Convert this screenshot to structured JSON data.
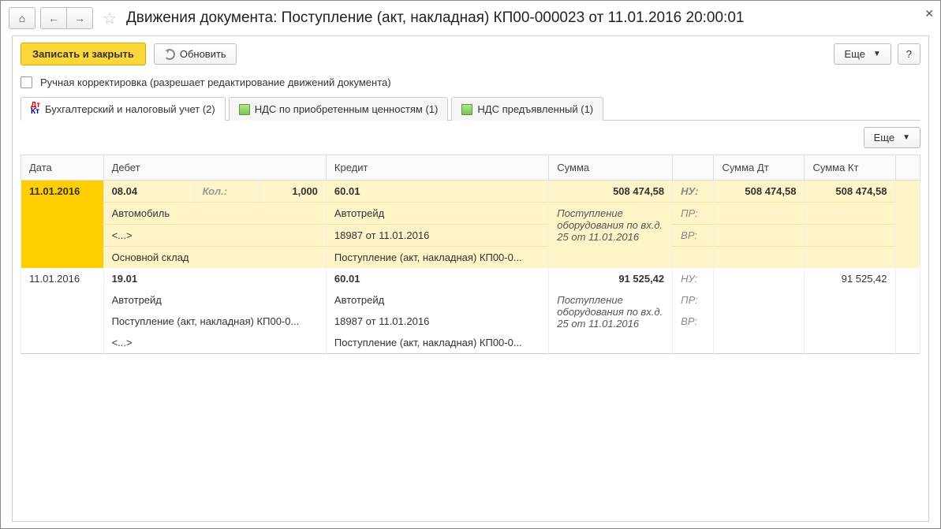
{
  "title": "Движения документа: Поступление (акт, накладная) КП00-000023 от 11.01.2016 20:00:01",
  "buttons": {
    "save_close": "Записать и закрыть",
    "refresh": "Обновить",
    "more": "Еще",
    "help": "?"
  },
  "checkbox": {
    "label": "Ручная корректировка (разрешает редактирование движений документа)"
  },
  "tabs": [
    {
      "label": "Бухгалтерский и налоговый учет (2)"
    },
    {
      "label": "НДС по приобретенным ценностям (1)"
    },
    {
      "label": "НДС предъявленный (1)"
    }
  ],
  "headers": {
    "date": "Дата",
    "debit": "Дебет",
    "credit": "Кредит",
    "sum": "Сумма",
    "sum_dt": "Сумма Дт",
    "sum_kt": "Сумма Кт"
  },
  "rows": [
    {
      "date": "11.01.2016",
      "debit_acc": "08.04",
      "kol_label": "Кол.:",
      "kol_val": "1,000",
      "credit_acc": "60.01",
      "sum": "508 474,58",
      "tag1": "НУ:",
      "sum_dt": "508 474,58",
      "sum_kt": "508 474,58",
      "d1": "Автомобиль",
      "c1": "Автотрейд",
      "note": "Поступление оборудования по вх.д. 25 от 11.01.2016",
      "tag2": "ПР:",
      "d2": "<...>",
      "c2": "18987 от 11.01.2016",
      "tag3": "ВР:",
      "d3": "Основной склад",
      "c3": "Поступление (акт, накладная) КП00-0..."
    },
    {
      "date": "11.01.2016",
      "debit_acc": "19.01",
      "credit_acc": "60.01",
      "sum": "91 525,42",
      "tag1": "НУ:",
      "sum_dt": "",
      "sum_kt": "91 525,42",
      "d1": "Автотрейд",
      "c1": "Автотрейд",
      "note": "Поступление оборудования по вх.д. 25 от 11.01.2016",
      "tag2": "ПР:",
      "d2": "Поступление (акт, накладная) КП00-0...",
      "c2": "18987 от 11.01.2016",
      "tag3": "ВР:",
      "d3": "<...>",
      "c3": "Поступление (акт, накладная) КП00-0..."
    }
  ]
}
